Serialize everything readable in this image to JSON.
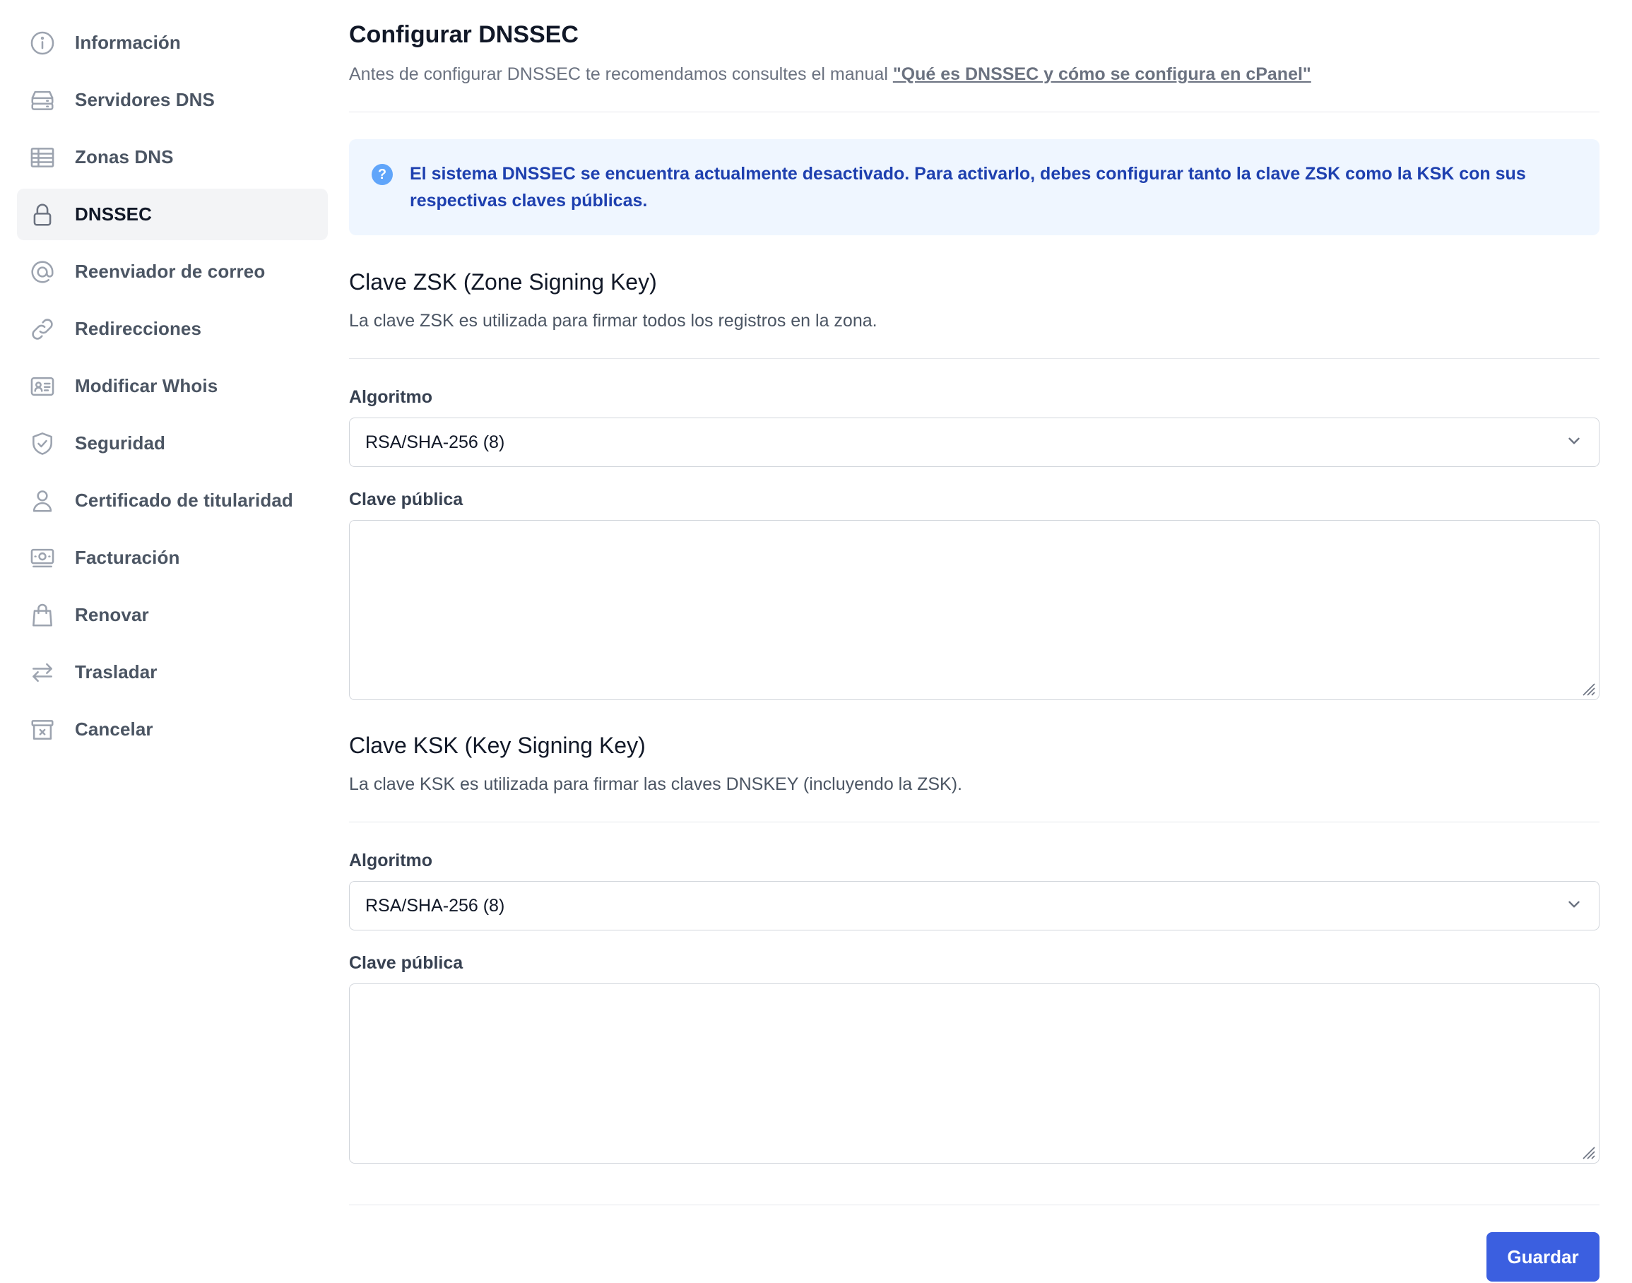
{
  "sidebar": {
    "items": [
      {
        "label": "Información",
        "icon": "info-icon",
        "active": false
      },
      {
        "label": "Servidores DNS",
        "icon": "server-icon",
        "active": false
      },
      {
        "label": "Zonas DNS",
        "icon": "table-icon",
        "active": false
      },
      {
        "label": "DNSSEC",
        "icon": "lock-icon",
        "active": true
      },
      {
        "label": "Reenviador de correo",
        "icon": "at-sign-icon",
        "active": false
      },
      {
        "label": "Redirecciones",
        "icon": "link-icon",
        "active": false
      },
      {
        "label": "Modificar Whois",
        "icon": "id-card-icon",
        "active": false
      },
      {
        "label": "Seguridad",
        "icon": "shield-check-icon",
        "active": false
      },
      {
        "label": "Certificado de titularidad",
        "icon": "user-icon",
        "active": false
      },
      {
        "label": "Facturación",
        "icon": "cash-icon",
        "active": false
      },
      {
        "label": "Renovar",
        "icon": "shopping-bag-icon",
        "active": false
      },
      {
        "label": "Trasladar",
        "icon": "arrows-swap-icon",
        "active": false
      },
      {
        "label": "Cancelar",
        "icon": "archive-x-icon",
        "active": false
      }
    ]
  },
  "main": {
    "title": "Configurar DNSSEC",
    "subtitle_prefix": "Antes de configurar DNSSEC te recomendamos consultes el manual ",
    "subtitle_link": "\"Qué es DNSSEC y cómo se configura en cPanel\"",
    "alert": {
      "icon": "question-circle-icon",
      "text": "El sistema DNSSEC se encuentra actualmente desactivado. Para activarlo, debes configurar tanto la clave ZSK como la KSK con sus respectivas claves públicas."
    },
    "zsk": {
      "title": "Clave ZSK (Zone Signing Key)",
      "description": "La clave ZSK es utilizada para firmar todos los registros en la zona.",
      "algorithm_label": "Algoritmo",
      "algorithm_value": "RSA/SHA-256 (8)",
      "public_key_label": "Clave pública",
      "public_key_value": ""
    },
    "ksk": {
      "title": "Clave KSK (Key Signing Key)",
      "description": "La clave KSK es utilizada para firmar las claves DNSKEY (incluyendo la ZSK).",
      "algorithm_label": "Algoritmo",
      "algorithm_value": "RSA/SHA-256 (8)",
      "public_key_label": "Clave pública",
      "public_key_value": ""
    },
    "save_label": "Guardar"
  },
  "colors": {
    "accent": "#3b5fe0",
    "alert_bg": "#eff6ff",
    "alert_text": "#1e40af",
    "active_bg": "#f3f4f6"
  }
}
